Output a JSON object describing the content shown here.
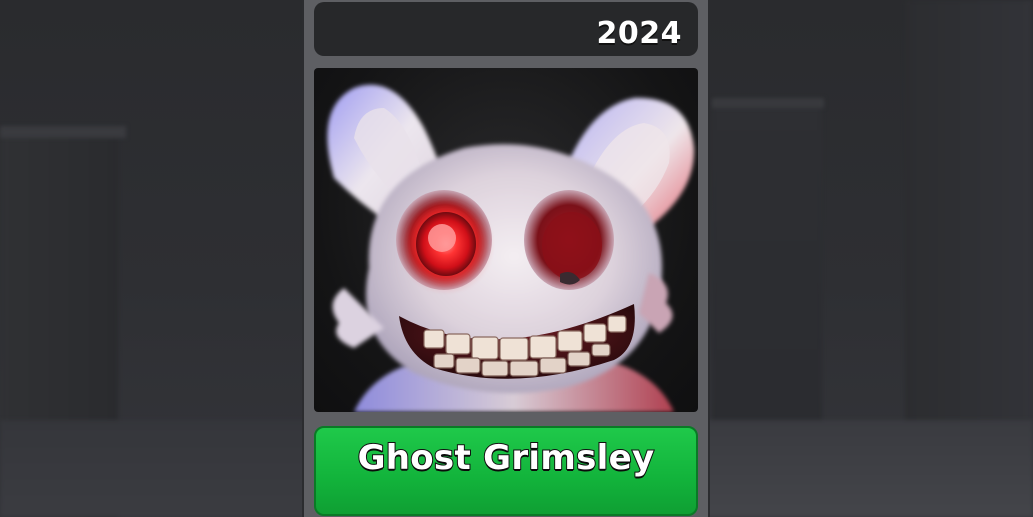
{
  "card": {
    "year": "2024",
    "character_name": "Ghost Grimsley",
    "portrait_subject": "ghost-bunny-character"
  },
  "colors": {
    "button_green": "#16b93f",
    "card_frame": "#5e5f63",
    "year_bar": "#27282a",
    "eye_glow": "#ff3030"
  }
}
